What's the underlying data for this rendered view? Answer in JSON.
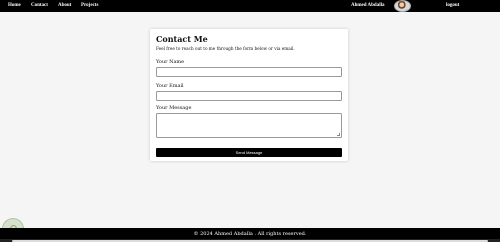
{
  "nav": {
    "items": [
      "Home",
      "Contact",
      "About",
      "Projects"
    ],
    "user_name": "Ahmed Abdalla",
    "logout_label": "logout"
  },
  "contact": {
    "title": "Contact Me",
    "intro": "Feel free to reach out to me through the form below or via email.",
    "name_label": "Your Name",
    "email_label": "Your Email",
    "message_label": "Your Message",
    "name_value": "",
    "email_value": "",
    "message_value": "",
    "send_label": "Send Message"
  },
  "footer": {
    "text": "© 2024 Ahmed Abdalla . All rights reserved."
  },
  "colors": {
    "nav_bg": "#000000",
    "page_bg": "#f5f5f5",
    "button_bg": "#000000"
  }
}
